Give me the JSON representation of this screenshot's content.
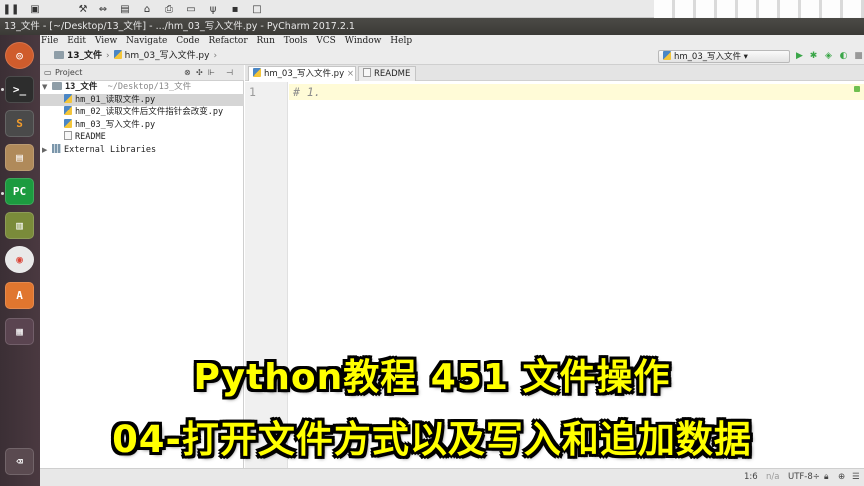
{
  "window": {
    "title": "13_文件 - [~/Desktop/13_文件] - .../hm_03_写入文件.py - PyCharm 2017.2.1"
  },
  "menu": [
    "File",
    "Edit",
    "View",
    "Navigate",
    "Code",
    "Refactor",
    "Run",
    "Tools",
    "VCS",
    "Window",
    "Help"
  ],
  "breadcrumb": {
    "folder": "13_文件",
    "file": "hm_03_写入文件.py"
  },
  "run_config": {
    "selected": "hm_03_写入文件"
  },
  "project_panel": {
    "label": "Project",
    "root": {
      "name": "13_文件",
      "path": "~/Desktop/13_文件"
    },
    "files": [
      "hm_01_读取文件.py",
      "hm_02_读取文件后文件指针会改变.py",
      "hm_03_写入文件.py",
      "README"
    ],
    "external": "External Libraries"
  },
  "editor": {
    "tabs": [
      "hm_03_写入文件.py",
      "README"
    ],
    "line_number": "1",
    "code": "# 1."
  },
  "status": {
    "position": "1:6",
    "na": "n/a",
    "encoding": "UTF-8÷"
  },
  "overlay": {
    "line1": "Python教程  451 文件操作",
    "line2": "04-打开文件方式以及写入和追加数据"
  },
  "colors": {
    "caption_fill": "#ffff00",
    "caption_outline": "#000000",
    "current_line": "#fffbd7",
    "launcher_bg": "#3b2f35"
  },
  "icons": {
    "launcher": [
      "ubuntu-dash-icon",
      "terminal-icon",
      "sublime-text-icon",
      "file-manager-icon",
      "pycharm-icon",
      "books-icon",
      "chrome-icon",
      "software-center-icon",
      "workspace-switcher-icon",
      "trash-icon"
    ]
  }
}
